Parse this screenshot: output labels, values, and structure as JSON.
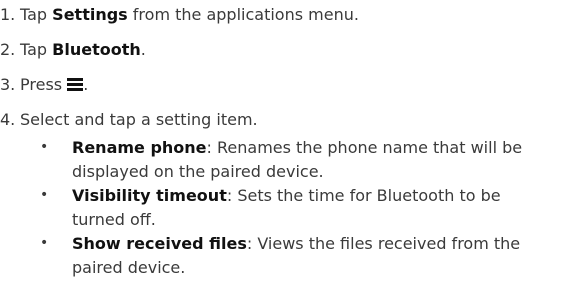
{
  "steps": [
    {
      "num": "1.",
      "pre": "Tap ",
      "bold": "Settings",
      "post": " from the applications menu."
    },
    {
      "num": "2.",
      "pre": "Tap ",
      "bold": "Bluetooth",
      "post": "."
    },
    {
      "num": "3.",
      "pre": "Press ",
      "icon": "menu-key-icon",
      "post": "."
    },
    {
      "num": "4.",
      "pre": "Select and tap a setting item.",
      "bold": "",
      "post": ""
    }
  ],
  "bullets": [
    {
      "mark": "•",
      "bold": "Rename phone",
      "line1": ": Renames the phone name that will be",
      "line2": "displayed on the paired device."
    },
    {
      "mark": "•",
      "bold": "Visibility timeout",
      "line1": ": Sets the time for Bluetooth to be",
      "line2": "turned off."
    },
    {
      "mark": "•",
      "bold": "Show received files",
      "line1": ": Views the files received from the",
      "line2": "paired device."
    }
  ]
}
